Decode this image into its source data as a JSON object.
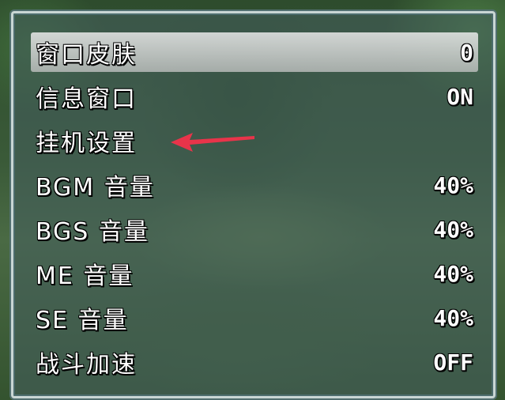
{
  "menu": {
    "items": [
      {
        "label": "窗口皮肤",
        "value": "0",
        "selected": true
      },
      {
        "label": "信息窗口",
        "value": "ON"
      },
      {
        "label": "挂机设置",
        "value": ""
      },
      {
        "label": "BGM 音量",
        "value": "40%"
      },
      {
        "label": "BGS 音量",
        "value": "40%"
      },
      {
        "label": "ME 音量",
        "value": "40%"
      },
      {
        "label": "SE 音量",
        "value": "40%"
      },
      {
        "label": "战斗加速",
        "value": "OFF"
      }
    ]
  },
  "annotation": {
    "icon": "red-arrow-icon",
    "color": "#e8344a"
  },
  "colors": {
    "window_border": "#c9d6d4",
    "selection": "#d9d9d9"
  }
}
